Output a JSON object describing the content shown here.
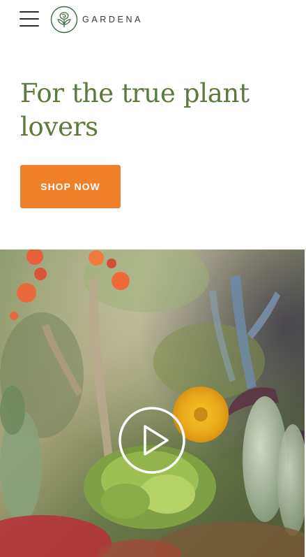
{
  "header": {
    "menu_icon": "hamburger-menu-icon",
    "logo_icon": "rose-logo-icon",
    "brand": "GARDENA"
  },
  "hero": {
    "title": "For the true plant lovers",
    "cta_label": "SHOP NOW"
  },
  "video": {
    "play_icon": "play-icon",
    "background": "succulent-plants-photo"
  },
  "colors": {
    "accent": "#f07f2a",
    "heading": "#5b7a3c",
    "logo": "#3f6a3f"
  }
}
